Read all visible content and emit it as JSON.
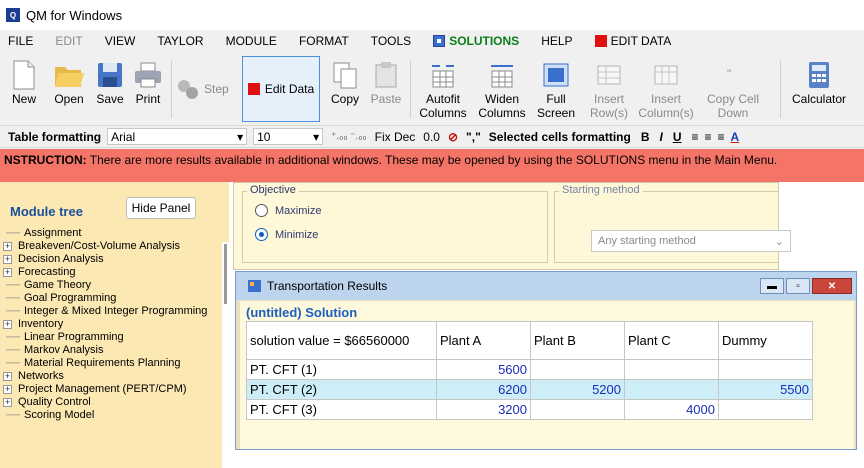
{
  "app": {
    "title": "QM for Windows"
  },
  "menu": {
    "items": [
      "FILE",
      "EDIT",
      "VIEW",
      "TAYLOR",
      "MODULE",
      "FORMAT",
      "TOOLS"
    ],
    "solutions": "SOLUTIONS",
    "help": "HELP",
    "edit_data": "EDIT DATA"
  },
  "toolbar": {
    "new": "New",
    "open": "Open",
    "save": "Save",
    "print": "Print",
    "step": "Step",
    "edit_data": "Edit Data",
    "copy": "Copy",
    "paste": "Paste",
    "autofit1": "Autofit",
    "autofit2": "Columns",
    "widen1": "Widen",
    "widen2": "Columns",
    "full1": "Full",
    "full2": "Screen",
    "insrow1": "Insert",
    "insrow2": "Row(s)",
    "inscol1": "Insert",
    "inscol2": "Column(s)",
    "copycell1": "Copy Cell",
    "copycell2": "Down",
    "calculator": "Calculator"
  },
  "format": {
    "label": "Table formatting",
    "font": "Arial",
    "size": "10",
    "fix_dec": "Fix Dec",
    "zero": "0.0",
    "comma": "\",\"",
    "selected": "Selected cells formatting",
    "bold": "B",
    "italic": "I",
    "underline": "U"
  },
  "instruction": {
    "prefix": "NSTRUCTION:",
    "text": " There are more results available in additional windows. These may be opened by using the SOLUTIONS menu in the Main Menu."
  },
  "sidebar": {
    "title": "Module tree",
    "hide": "Hide Panel",
    "items": [
      {
        "label": "Assignment",
        "expand": false
      },
      {
        "label": "Breakeven/Cost-Volume Analysis",
        "expand": true
      },
      {
        "label": "Decision Analysis",
        "expand": true
      },
      {
        "label": "Forecasting",
        "expand": true
      },
      {
        "label": "Game Theory",
        "expand": false
      },
      {
        "label": "Goal Programming",
        "expand": false
      },
      {
        "label": "Integer & Mixed Integer Programming",
        "expand": false
      },
      {
        "label": "Inventory",
        "expand": true
      },
      {
        "label": "Linear Programming",
        "expand": false
      },
      {
        "label": "Markov Analysis",
        "expand": false
      },
      {
        "label": "Material Requirements Planning",
        "expand": false
      },
      {
        "label": "Networks",
        "expand": true
      },
      {
        "label": "Project Management (PERT/CPM)",
        "expand": true
      },
      {
        "label": "Quality Control",
        "expand": true
      },
      {
        "label": "Scoring Model",
        "expand": false
      }
    ]
  },
  "objective": {
    "title": "Objective",
    "maximize": "Maximize",
    "minimize": "Minimize",
    "selected": "Minimize"
  },
  "starting": {
    "title": "Starting method",
    "value": "Any starting method"
  },
  "results": {
    "window_title": "Transportation Results",
    "caption": "(untitled) Solution",
    "corner": "solution value = $66560000",
    "columns": [
      "Plant A",
      "Plant B",
      "Plant C",
      "Dummy"
    ],
    "rows": [
      {
        "label": "PT. CFT (1)",
        "cells": [
          "5600",
          "",
          "",
          ""
        ]
      },
      {
        "label": "PT. CFT (2)",
        "cells": [
          "6200",
          "5200",
          "",
          "5500"
        ]
      },
      {
        "label": "PT. CFT (3)",
        "cells": [
          "3200",
          "",
          "4000",
          ""
        ]
      }
    ]
  }
}
